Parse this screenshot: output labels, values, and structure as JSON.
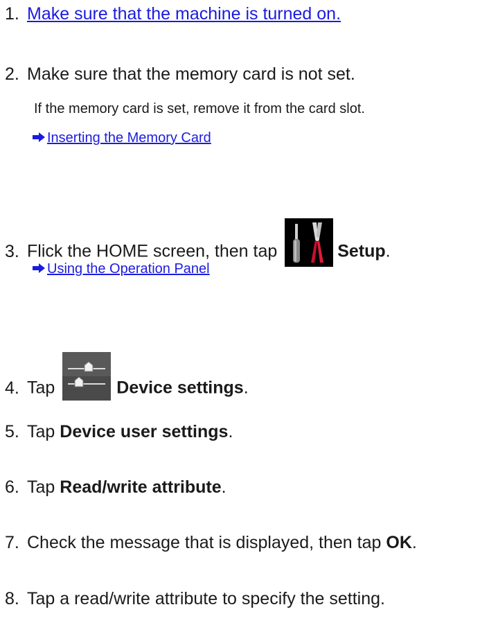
{
  "steps": [
    {
      "num": "1.",
      "link": "Make sure that the machine is turned on."
    },
    {
      "num": "2.",
      "text": "Make sure that the memory card is not set.",
      "note": "If the memory card is set, remove it from the card slot.",
      "ref_link": "Inserting the Memory Card"
    },
    {
      "num": "3.",
      "text_before": "Flick the HOME screen, then tap",
      "icon": "setup-tools-icon",
      "bold": "Setup",
      "text_after": ".",
      "ref_link": "Using the Operation Panel"
    },
    {
      "num": "4.",
      "text_before": "Tap",
      "icon": "device-settings-sliders-icon",
      "bold": "Device settings",
      "text_after": "."
    },
    {
      "num": "5.",
      "text_before": "Tap",
      "bold": "Device user settings",
      "text_after": "."
    },
    {
      "num": "6.",
      "text_before": "Tap",
      "bold": "Read/write attribute",
      "text_after": "."
    },
    {
      "num": "7.",
      "text_before": "Check the message that is displayed, then tap",
      "bold": "OK",
      "text_after": "."
    },
    {
      "num": "8.",
      "text": "Tap a read/write attribute to specify the setting."
    }
  ],
  "colors": {
    "link": "#1b1be0",
    "text": "#1a1a1a",
    "arrow": "#1b1be0"
  }
}
